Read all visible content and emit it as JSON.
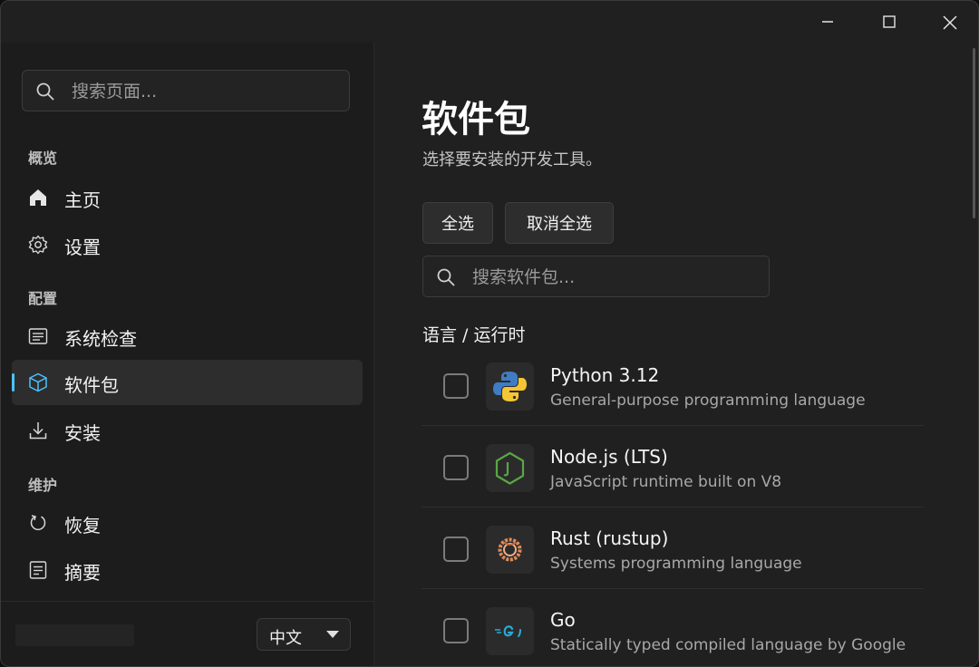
{
  "sidebar": {
    "search_placeholder": "搜索页面...",
    "groups": [
      {
        "label": "概览",
        "items": [
          {
            "label": "主页",
            "icon": "home-icon"
          },
          {
            "label": "设置",
            "icon": "gear-icon"
          }
        ]
      },
      {
        "label": "配置",
        "items": [
          {
            "label": "系统检查",
            "icon": "list-icon"
          },
          {
            "label": "软件包",
            "icon": "package-icon",
            "active": true
          },
          {
            "label": "安装",
            "icon": "download-icon"
          }
        ]
      },
      {
        "label": "维护",
        "items": [
          {
            "label": "恢复",
            "icon": "refresh-icon"
          },
          {
            "label": "摘要",
            "icon": "document-icon"
          }
        ]
      }
    ],
    "language": "中文"
  },
  "main": {
    "title": "软件包",
    "subtitle": "选择要安装的开发工具。",
    "select_all": "全选",
    "deselect_all": "取消全选",
    "search_placeholder": "搜索软件包...",
    "section": "语言 / 运行时",
    "packages": [
      {
        "name": "Python 3.12",
        "description": "General-purpose programming language",
        "icon": "python-logo-icon",
        "checked": false
      },
      {
        "name": "Node.js (LTS)",
        "description": "JavaScript runtime built on V8",
        "icon": "nodejs-logo-icon",
        "checked": false
      },
      {
        "name": "Rust (rustup)",
        "description": "Systems programming language",
        "icon": "rust-logo-icon",
        "checked": false
      },
      {
        "name": "Go",
        "description": "Statically typed compiled language by Google",
        "icon": "go-logo-icon",
        "checked": false
      }
    ]
  },
  "colors": {
    "accent": "#4cc2ff",
    "background": "#202020",
    "sidebar": "#1c1c1c"
  }
}
